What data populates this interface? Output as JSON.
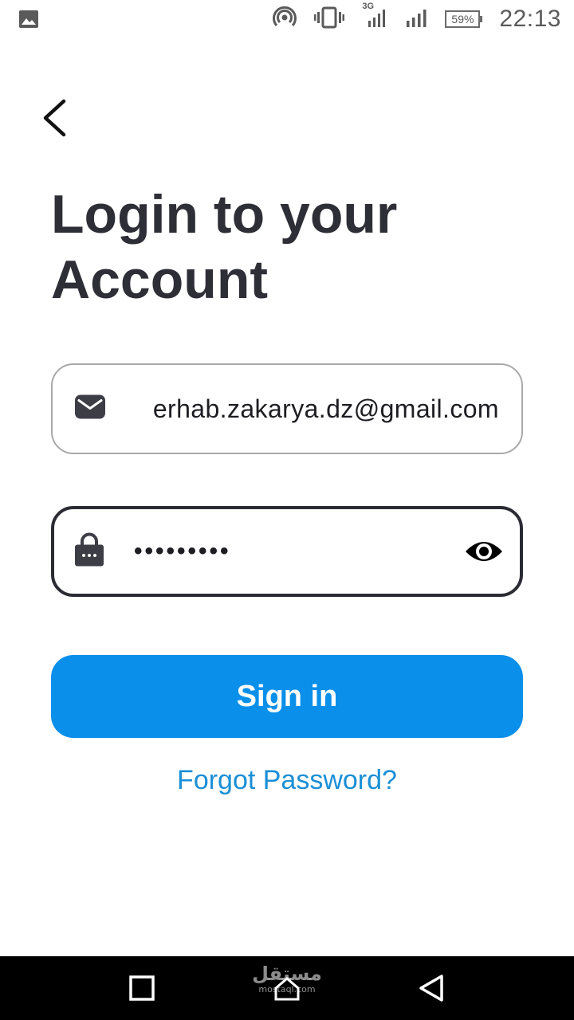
{
  "status_bar": {
    "time": "22:13",
    "battery_percent": "59%",
    "network_type": "3G",
    "icons": [
      "gallery-icon",
      "hotspot-icon",
      "vibrate-icon",
      "signal-3g-icon",
      "signal-icon",
      "battery-icon"
    ]
  },
  "header": {
    "back_icon": "chevron-left-icon"
  },
  "title": {
    "line1": "Login to your",
    "line2": "Account"
  },
  "form": {
    "email": {
      "icon": "mail-icon",
      "value_visible": "erhab.zakarya.dz@gmail.com"
    },
    "password": {
      "icon": "lock-icon",
      "value": "•••••••••",
      "toggle_icon": "eye-icon"
    },
    "submit_label": "Sign in",
    "forgot_label": "Forgot Password?"
  },
  "colors": {
    "primary": "#0a8fea",
    "link": "#1a8fd6",
    "text": "#2e2e36",
    "email_border": "#a9a9a9",
    "password_border": "#2b2b33"
  },
  "nav_bar": {
    "icons": [
      "recents-square-icon",
      "home-icon",
      "back-triangle-icon"
    ]
  },
  "watermark": {
    "arabic": "مستقل",
    "latin": "mostaql.com"
  }
}
